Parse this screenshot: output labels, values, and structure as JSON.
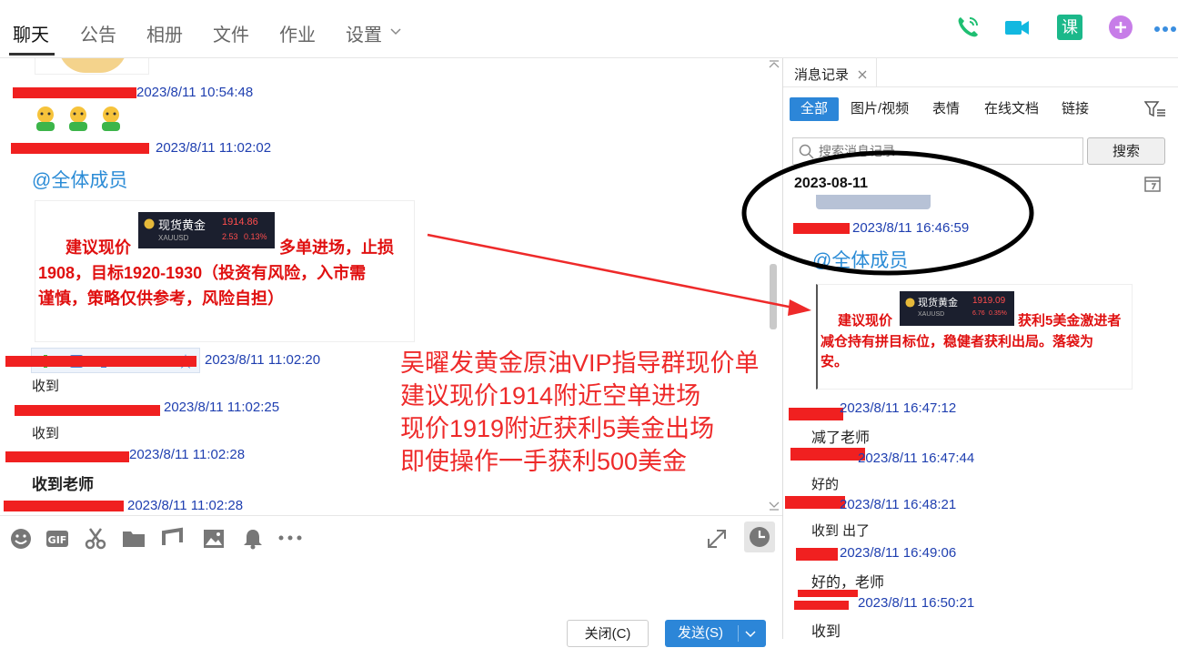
{
  "tabs": [
    {
      "label": "聊天"
    },
    {
      "label": "公告"
    },
    {
      "label": "相册"
    },
    {
      "label": "文件"
    },
    {
      "label": "作业"
    },
    {
      "label": "设置"
    }
  ],
  "top_icons": [
    "phone-icon",
    "video-call-icon",
    "course-icon",
    "add-icon",
    "more-icon"
  ],
  "course_icon_text": "课",
  "chat": {
    "messages": [
      {
        "time": "2023/8/11 10:54:48"
      },
      {
        "time": "2023/8/11 11:02:02",
        "mention": "@全体成员"
      },
      {
        "time": "2023/8/11 11:02:20",
        "text": "收到"
      },
      {
        "time": "2023/8/11 11:02:25",
        "text": "收到"
      },
      {
        "time": "2023/8/11 11:02:28",
        "text": "收到老师"
      },
      {
        "time": "2023/8/11 11:02:28"
      }
    ],
    "card1": {
      "badge_title": "现货黄金",
      "badge_code": "XAUUSD",
      "badge_price": "1914.86",
      "badge_change": "2.53",
      "badge_pct": "0.13%",
      "text_a": "建议现价",
      "text_b": "多单进场，止损",
      "text_c": "1908，目标1920-1930（投资有风险，入市需",
      "text_d": "谨慎，策略仅供参考，风险自担）"
    }
  },
  "toolbar": {
    "close_label": "关闭(C)",
    "send_label": "发送(S)"
  },
  "overlay_lines": [
    "吴曜发黄金原油VIP指导群现价单",
    "建议现价1914附近空单进场",
    "现价1919附近获利5美金出场",
    "即使操作一手获利500美金"
  ],
  "panel": {
    "title": "消息记录",
    "filters": [
      "全部",
      "图片/视频",
      "表情",
      "在线文档",
      "链接"
    ],
    "search_placeholder": "搜索消息记录",
    "search_button": "搜索",
    "date": "2023-08-11",
    "messages": [
      {
        "time": "2023/8/11 16:46:59",
        "mention": "@全体成员"
      },
      {
        "time": "2023/8/11 16:47:12",
        "text": "减了老师"
      },
      {
        "time": "2023/8/11 16:47:44",
        "text": "好的"
      },
      {
        "time": "2023/8/11 16:48:21",
        "text": "收到  出了"
      },
      {
        "time": "2023/8/11 16:49:06",
        "text": "好的，老师"
      },
      {
        "time": "2023/8/11 16:50:21",
        "text": "收到"
      }
    ],
    "card2": {
      "badge_title": "现货黄金",
      "badge_code": "XAUUSD",
      "badge_price": "1919.09",
      "badge_change": "6.76",
      "badge_pct": "0.35%",
      "text_a": "建议现价",
      "text_b": "获利5美金激进者",
      "text_c": "减仓持有拼目标位，稳健者获利出局。落袋为",
      "text_d": "安。"
    }
  },
  "colors": {
    "accent": "#2c86d8",
    "timestamp": "#1f3fb0",
    "mention": "#2a8bd6",
    "overlay_red": "#ee2a2a"
  }
}
